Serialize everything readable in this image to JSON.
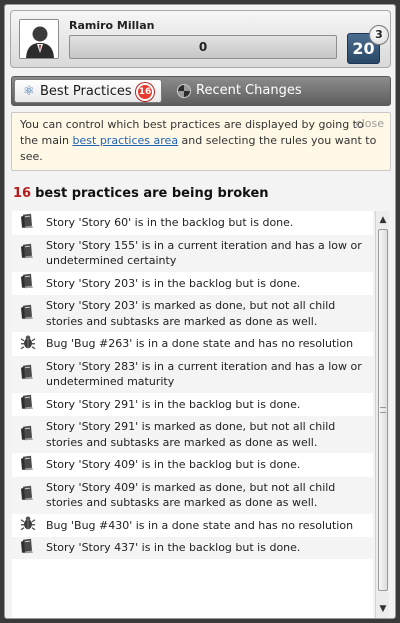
{
  "user": {
    "name": "Ramiro Millan",
    "progress_value": "0",
    "progress_fraction": 0,
    "score": "20",
    "score_badge": "3"
  },
  "tabs": {
    "best": {
      "label": "Best Practices",
      "count": "16"
    },
    "recent": {
      "label": "Recent Changes"
    }
  },
  "info": {
    "close_label": "close",
    "text_before": "You can control which best practices are displayed by going to the main ",
    "link": "best practices area",
    "text_after": " and selecting the rules you want to see."
  },
  "heading": {
    "count": "16",
    "text": "best practices are being broken"
  },
  "items": [
    {
      "icon": "book-icon",
      "text": "Story 'Story 60' is in the backlog but is done."
    },
    {
      "icon": "book-icon",
      "text": "Story 'Story 155' is in a current iteration and has a low or undetermined certainty"
    },
    {
      "icon": "book-icon",
      "text": "Story 'Story 203' is in the backlog but is done."
    },
    {
      "icon": "book-icon",
      "text": "Story 'Story 203' is marked as done, but not all child stories and subtasks are marked as done as well."
    },
    {
      "icon": "bug-icon",
      "text": "Bug 'Bug #263' is in a done state and has no resolution"
    },
    {
      "icon": "book-icon",
      "text": "Story 'Story 283' is in a current iteration and has a low or undetermined maturity"
    },
    {
      "icon": "book-icon",
      "text": "Story 'Story 291' is in the backlog but is done."
    },
    {
      "icon": "book-icon",
      "text": "Story 'Story 291' is marked as done, but not all child stories and subtasks are marked as done as well."
    },
    {
      "icon": "book-icon",
      "text": "Story 'Story 409' is in the backlog but is done."
    },
    {
      "icon": "book-icon",
      "text": "Story 'Story 409' is marked as done, but not all child stories and subtasks are marked as done as well."
    },
    {
      "icon": "bug-icon",
      "text": "Bug 'Bug #430' is in a done state and has no resolution"
    },
    {
      "icon": "book-icon",
      "text": "Story 'Story 437' is in the backlog but is done."
    }
  ]
}
